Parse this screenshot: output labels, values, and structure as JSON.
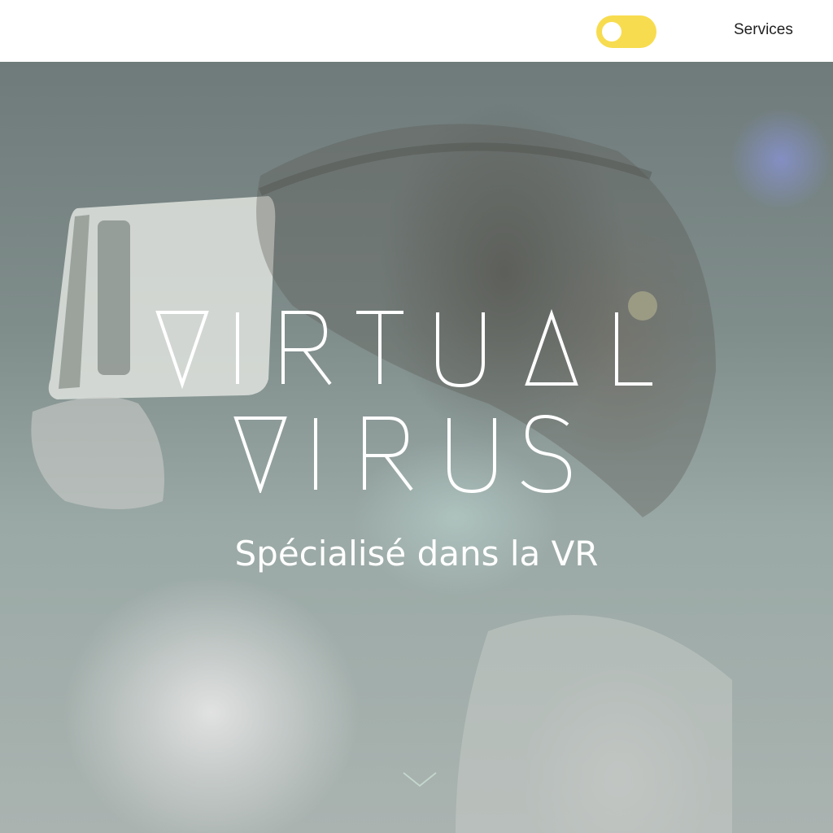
{
  "header": {
    "theme_toggle_state": "off",
    "toggle_color": "#f7dc4f",
    "nav": {
      "services_label": "Services"
    }
  },
  "hero": {
    "logo_text": "VIRTUAL VIRUS",
    "tagline": "Spécialisé dans la VR",
    "scroll_icon": "chevron-down-icon"
  }
}
